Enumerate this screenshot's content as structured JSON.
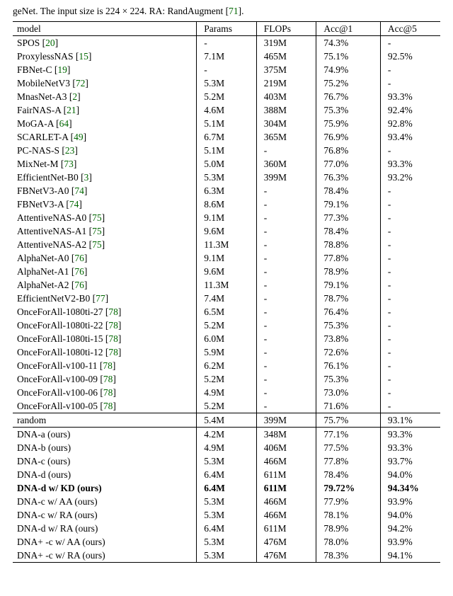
{
  "caption_prefix": "geNet. The input size is 224 × 224. RA: RandAugment [",
  "caption_ref": "71",
  "caption_suffix": "].",
  "hdr": {
    "model": "model",
    "params": "Params",
    "flops": "FLOPs",
    "acc1": "Acc@1",
    "acc5": "Acc@5"
  },
  "group1": [
    {
      "name": "SPOS [",
      "ref": "20",
      "suf": "]",
      "params": "-",
      "flops": "319M",
      "acc1": "74.3%",
      "acc5": "-"
    },
    {
      "name": "ProxylessNAS [",
      "ref": "15",
      "suf": "]",
      "params": "7.1M",
      "flops": "465M",
      "acc1": "75.1%",
      "acc5": "92.5%"
    },
    {
      "name": "FBNet-C [",
      "ref": "19",
      "suf": "]",
      "params": "-",
      "flops": "375M",
      "acc1": "74.9%",
      "acc5": "-"
    },
    {
      "name": "MobileNetV3 [",
      "ref": "72",
      "suf": "]",
      "params": "5.3M",
      "flops": "219M",
      "acc1": "75.2%",
      "acc5": "-"
    },
    {
      "name": "MnasNet-A3 [",
      "ref": "2",
      "suf": "]",
      "params": "5.2M",
      "flops": "403M",
      "acc1": "76.7%",
      "acc5": "93.3%"
    },
    {
      "name": "FairNAS-A [",
      "ref": "21",
      "suf": "]",
      "params": "4.6M",
      "flops": "388M",
      "acc1": "75.3%",
      "acc5": "92.4%"
    },
    {
      "name": "MoGA-A [",
      "ref": "64",
      "suf": "]",
      "params": "5.1M",
      "flops": "304M",
      "acc1": "75.9%",
      "acc5": "92.8%"
    },
    {
      "name": "SCARLET-A [",
      "ref": "49",
      "suf": "]",
      "params": "6.7M",
      "flops": "365M",
      "acc1": "76.9%",
      "acc5": "93.4%"
    },
    {
      "name": "PC-NAS-S [",
      "ref": "23",
      "suf": "]",
      "params": "5.1M",
      "flops": "-",
      "acc1": "76.8%",
      "acc5": "-"
    },
    {
      "name": "MixNet-M [",
      "ref": "73",
      "suf": "]",
      "params": "5.0M",
      "flops": "360M",
      "acc1": "77.0%",
      "acc5": "93.3%"
    },
    {
      "name": "EfficientNet-B0 [",
      "ref": "3",
      "suf": "]",
      "params": "5.3M",
      "flops": "399M",
      "acc1": "76.3%",
      "acc5": "93.2%"
    },
    {
      "name": "FBNetV3-A0 [",
      "ref": "74",
      "suf": "]",
      "params": "6.3M",
      "flops": "-",
      "acc1": "78.4%",
      "acc5": "-"
    },
    {
      "name": "FBNetV3-A [",
      "ref": "74",
      "suf": "]",
      "params": "8.6M",
      "flops": "-",
      "acc1": "79.1%",
      "acc5": "-"
    },
    {
      "name": "AttentiveNAS-A0 [",
      "ref": "75",
      "suf": "]",
      "params": "9.1M",
      "flops": "-",
      "acc1": "77.3%",
      "acc5": "-"
    },
    {
      "name": "AttentiveNAS-A1 [",
      "ref": "75",
      "suf": "]",
      "params": "9.6M",
      "flops": "-",
      "acc1": "78.4%",
      "acc5": "-"
    },
    {
      "name": "AttentiveNAS-A2 [",
      "ref": "75",
      "suf": "]",
      "params": "11.3M",
      "flops": "-",
      "acc1": "78.8%",
      "acc5": "-"
    },
    {
      "name": "AlphaNet-A0 [",
      "ref": "76",
      "suf": "]",
      "params": "9.1M",
      "flops": "-",
      "acc1": "77.8%",
      "acc5": "-"
    },
    {
      "name": "AlphaNet-A1 [",
      "ref": "76",
      "suf": "]",
      "params": "9.6M",
      "flops": "-",
      "acc1": "78.9%",
      "acc5": "-"
    },
    {
      "name": "AlphaNet-A2 [",
      "ref": "76",
      "suf": "]",
      "params": "11.3M",
      "flops": "-",
      "acc1": "79.1%",
      "acc5": "-"
    },
    {
      "name": "EfficientNetV2-B0 [",
      "ref": "77",
      "suf": "]",
      "params": "7.4M",
      "flops": "-",
      "acc1": "78.7%",
      "acc5": "-"
    },
    {
      "name": "OnceForAll-1080ti-27 [",
      "ref": "78",
      "suf": "]",
      "params": "6.5M",
      "flops": "-",
      "acc1": "76.4%",
      "acc5": "-"
    },
    {
      "name": "OnceForAll-1080ti-22 [",
      "ref": "78",
      "suf": "]",
      "params": "5.2M",
      "flops": "-",
      "acc1": "75.3%",
      "acc5": "-"
    },
    {
      "name": "OnceForAll-1080ti-15 [",
      "ref": "78",
      "suf": "]",
      "params": "6.0M",
      "flops": "-",
      "acc1": "73.8%",
      "acc5": "-"
    },
    {
      "name": "OnceForAll-1080ti-12 [",
      "ref": "78",
      "suf": "]",
      "params": "5.9M",
      "flops": "-",
      "acc1": "72.6%",
      "acc5": "-"
    },
    {
      "name": "OnceForAll-v100-11 [",
      "ref": "78",
      "suf": "]",
      "params": "6.2M",
      "flops": "-",
      "acc1": "76.1%",
      "acc5": "-"
    },
    {
      "name": "OnceForAll-v100-09 [",
      "ref": "78",
      "suf": "]",
      "params": "5.2M",
      "flops": "-",
      "acc1": "75.3%",
      "acc5": "-"
    },
    {
      "name": "OnceForAll-v100-06 [",
      "ref": "78",
      "suf": "]",
      "params": "4.9M",
      "flops": "-",
      "acc1": "73.0%",
      "acc5": "-"
    },
    {
      "name": "OnceForAll-v100-05 [",
      "ref": "78",
      "suf": "]",
      "params": "5.2M",
      "flops": "-",
      "acc1": "71.6%",
      "acc5": "-"
    }
  ],
  "group2": [
    {
      "name": "random",
      "params": "5.4M",
      "flops": "399M",
      "acc1": "75.7%",
      "acc5": "93.1%"
    }
  ],
  "group3": [
    {
      "name": "DNA-a (ours)",
      "params": "4.2M",
      "flops": "348M",
      "acc1": "77.1%",
      "acc5": "93.3%"
    },
    {
      "name": "DNA-b (ours)",
      "params": "4.9M",
      "flops": "406M",
      "acc1": "77.5%",
      "acc5": "93.3%"
    },
    {
      "name": "DNA-c (ours)",
      "params": "5.3M",
      "flops": "466M",
      "acc1": "77.8%",
      "acc5": "93.7%"
    },
    {
      "name": "DNA-d (ours)",
      "params": "6.4M",
      "flops": "611M",
      "acc1": "78.4%",
      "acc5": "94.0%"
    },
    {
      "name": "DNA-d w/ KD (ours)",
      "params": "6.4M",
      "flops": "611M",
      "acc1": "79.72%",
      "acc5": "94.34%",
      "bold": true
    },
    {
      "name": "DNA-c w/ AA (ours)",
      "params": "5.3M",
      "flops": "466M",
      "acc1": "77.9%",
      "acc5": "93.9%"
    },
    {
      "name": "DNA-c w/ RA (ours)",
      "params": "5.3M",
      "flops": "466M",
      "acc1": "78.1%",
      "acc5": "94.0%"
    },
    {
      "name": "DNA-d w/ RA (ours)",
      "params": "6.4M",
      "flops": "611M",
      "acc1": "78.9%",
      "acc5": "94.2%"
    },
    {
      "name": "DNA+ -c w/ AA (ours)",
      "params": "5.3M",
      "flops": "476M",
      "acc1": "78.0%",
      "acc5": "93.9%"
    },
    {
      "name": "DNA+ -c w/ RA (ours)",
      "params": "5.3M",
      "flops": "476M",
      "acc1": "78.3%",
      "acc5": "94.1%"
    }
  ]
}
